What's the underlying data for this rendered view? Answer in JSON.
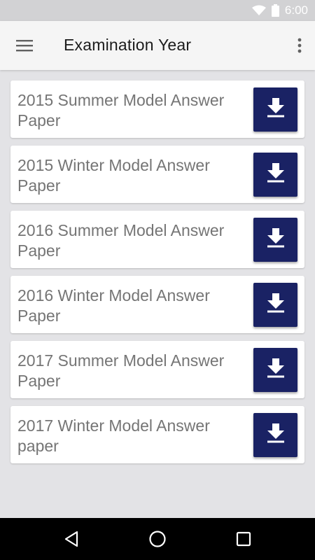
{
  "status_bar": {
    "time": "6:00",
    "icons": [
      "wifi-icon",
      "battery-icon"
    ]
  },
  "app_bar": {
    "title": "Examination Year",
    "menu_icon": "hamburger-menu-icon",
    "overflow_icon": "more-vertical-icon"
  },
  "papers": [
    {
      "label": "2015 Summer Model Answer Paper",
      "icon": "download-icon"
    },
    {
      "label": "2015 Winter Model Answer Paper",
      "icon": "download-icon"
    },
    {
      "label": "2016 Summer Model Answer Paper",
      "icon": "download-icon"
    },
    {
      "label": "2016 Winter Model Answer Paper",
      "icon": "download-icon"
    },
    {
      "label": "2017 Summer Model Answer Paper",
      "icon": "download-icon"
    },
    {
      "label": "2017 Winter Model Answer paper",
      "icon": "download-icon"
    }
  ],
  "nav_bar": {
    "buttons": [
      "back-icon",
      "home-icon",
      "recents-icon"
    ]
  },
  "colors": {
    "download_button": "#1a2264",
    "background": "#e3e3e6",
    "card_text": "#757575"
  }
}
